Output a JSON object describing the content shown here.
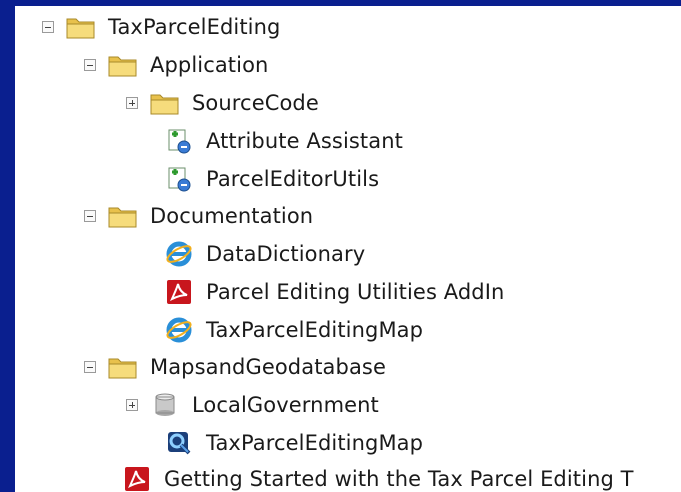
{
  "tree": {
    "root": {
      "label": "TaxParcelEditing"
    },
    "application": {
      "label": "Application"
    },
    "source_code": {
      "label": "SourceCode"
    },
    "attribute_assistant": {
      "label": "Attribute Assistant"
    },
    "parcel_editor_utils": {
      "label": "ParcelEditorUtils"
    },
    "documentation": {
      "label": "Documentation"
    },
    "data_dictionary": {
      "label": "DataDictionary"
    },
    "addin_pdf": {
      "label": "Parcel Editing Utilities AddIn"
    },
    "map_doc": {
      "label": "TaxParcelEditingMap"
    },
    "maps_geodatabase": {
      "label": "MapsandGeodatabase"
    },
    "local_government": {
      "label": "LocalGovernment"
    },
    "map_mxd": {
      "label": "TaxParcelEditingMap"
    },
    "getting_started": {
      "label": "Getting Started with the Tax Parcel Editing T"
    }
  },
  "colors": {
    "background": "#0a1f8f",
    "folder": "#f4d56a",
    "pdf": "#c8161d",
    "ie": "#2a8fd8"
  }
}
